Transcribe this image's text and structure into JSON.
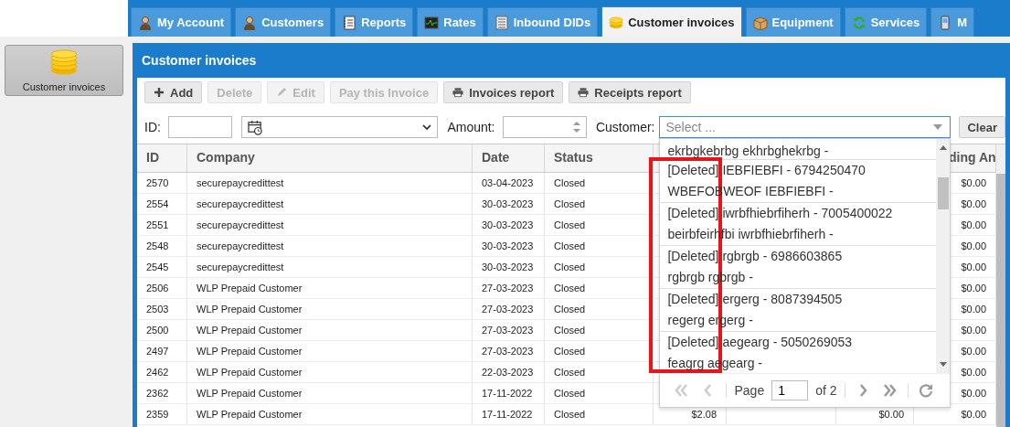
{
  "tabs": [
    {
      "label": "My Account",
      "selected": false
    },
    {
      "label": "Customers",
      "selected": false
    },
    {
      "label": "Reports",
      "selected": false
    },
    {
      "label": "Rates",
      "selected": false
    },
    {
      "label": "Inbound DIDs",
      "selected": false
    },
    {
      "label": "Customer invoices",
      "selected": true
    },
    {
      "label": "Equipment",
      "selected": false
    },
    {
      "label": "Services",
      "selected": false
    },
    {
      "label": "M",
      "selected": false
    }
  ],
  "sidebar": {
    "items": [
      {
        "label": "Customer invoices",
        "selected": true
      }
    ]
  },
  "panel": {
    "title": "Customer invoices",
    "toolbar": [
      {
        "label": "Add",
        "disabled": false
      },
      {
        "label": "Delete",
        "disabled": true
      },
      {
        "label": "Edit",
        "disabled": true
      },
      {
        "label": "Pay this Invoice",
        "disabled": true
      },
      {
        "label": "Invoices report",
        "disabled": false
      },
      {
        "label": "Receipts report",
        "disabled": false
      }
    ],
    "filters": {
      "id_label": "ID:",
      "amount_label": "Amount:",
      "customer_label": "Customer:",
      "customer_placeholder": "Select ...",
      "clear": "Clear"
    },
    "customer_dropdown": {
      "items": [
        {
          "lines": [
            "ekrbgkebrbg ekhrbghekrbg -"
          ]
        },
        {
          "lines": [
            "[Deleted] IEBFIEBFI - 6794250470",
            "WBEFOBWEOF IEBFIEBFI -"
          ]
        },
        {
          "lines": [
            "[Deleted] iwrbfhiebrfiherh - 7005400022",
            "beirbfeirhfbi iwrbfhiebrfiherh -"
          ]
        },
        {
          "lines": [
            "[Deleted] rgbrgb - 6986603865",
            "rgbrgb rgbrgb -"
          ]
        },
        {
          "lines": [
            "[Deleted] ergerg - 8087394505",
            "regerg ergerg -"
          ]
        },
        {
          "lines": [
            "[Deleted] aegearg - 5050269053",
            "feagrg aegearg -"
          ]
        }
      ],
      "pager": {
        "page_label": "Page",
        "page": "1",
        "of": "of 2"
      }
    },
    "table": {
      "columns": [
        "ID",
        "Company",
        "Date",
        "Status",
        null,
        null,
        null,
        "ding An"
      ],
      "rows": [
        {
          "cells": [
            "2570",
            "securepaycredittest",
            "03-04-2023",
            "Closed",
            null,
            null,
            null,
            "$0.00"
          ]
        },
        {
          "cells": [
            "2554",
            "securepaycredittest",
            "30-03-2023",
            "Closed",
            null,
            null,
            null,
            "$0.00"
          ]
        },
        {
          "cells": [
            "2551",
            "securepaycredittest",
            "30-03-2023",
            "Closed",
            null,
            null,
            null,
            "$0.00"
          ]
        },
        {
          "cells": [
            "2548",
            "securepaycredittest",
            "30-03-2023",
            "Closed",
            null,
            null,
            null,
            "$0.00"
          ]
        },
        {
          "cells": [
            "2545",
            "securepaycredittest",
            "30-03-2023",
            "Closed",
            null,
            null,
            null,
            "$0.00"
          ]
        },
        {
          "cells": [
            "2506",
            "WLP Prepaid Customer",
            "27-03-2023",
            "Closed",
            null,
            null,
            null,
            "$0.00"
          ]
        },
        {
          "cells": [
            "2503",
            "WLP Prepaid Customer",
            "27-03-2023",
            "Closed",
            null,
            null,
            null,
            "$0.00"
          ]
        },
        {
          "cells": [
            "2500",
            "WLP Prepaid Customer",
            "27-03-2023",
            "Closed",
            null,
            null,
            null,
            "$0.00"
          ]
        },
        {
          "cells": [
            "2497",
            "WLP Prepaid Customer",
            "27-03-2023",
            "Closed",
            null,
            null,
            null,
            "$0.00"
          ]
        },
        {
          "cells": [
            "2462",
            "WLP Prepaid Customer",
            "22-03-2023",
            "Closed",
            null,
            null,
            null,
            "$0.00"
          ]
        },
        {
          "cells": [
            "2362",
            "WLP Prepaid Customer",
            "17-11-2022",
            "Closed",
            null,
            null,
            null,
            "$0.00"
          ]
        },
        {
          "cells": [
            "2359",
            "WLP Prepaid Customer",
            "17-11-2022",
            "Closed",
            "$2.08",
            null,
            "$0.00",
            "$0.00"
          ]
        }
      ]
    }
  }
}
